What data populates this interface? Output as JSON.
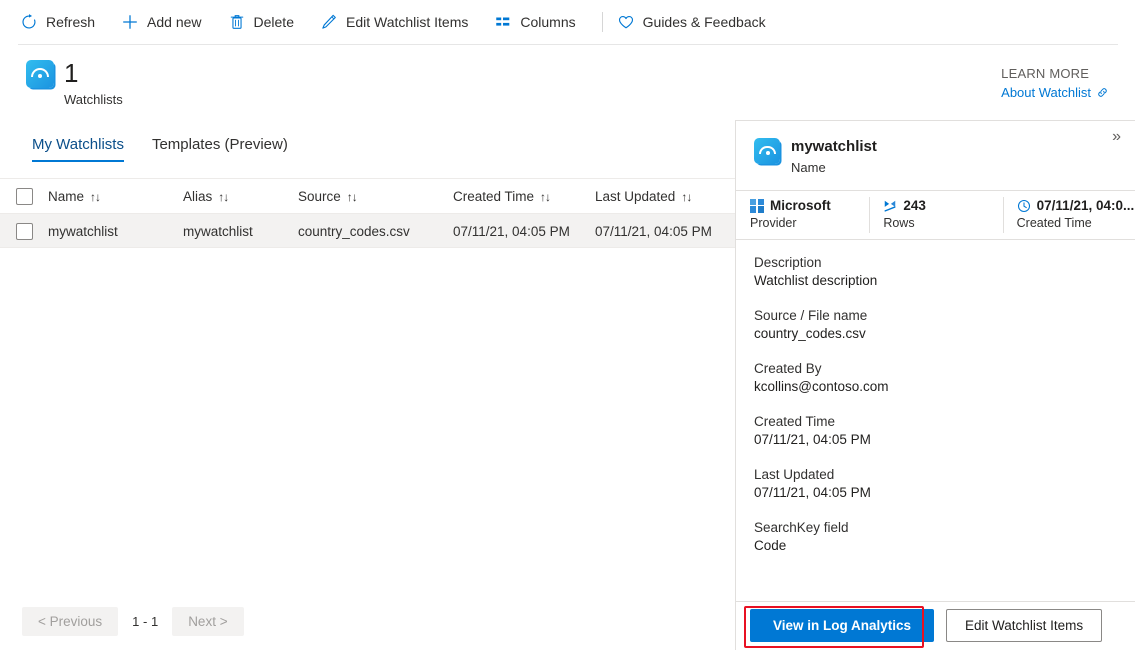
{
  "toolbar": {
    "items": [
      {
        "label": "Refresh",
        "icon": "refresh-icon"
      },
      {
        "label": "Add new",
        "icon": "plus-icon"
      },
      {
        "label": "Delete",
        "icon": "trash-icon"
      },
      {
        "label": "Edit Watchlist Items",
        "icon": "pencil-icon"
      },
      {
        "label": "Columns",
        "icon": "columns-icon"
      },
      {
        "label": "Guides & Feedback",
        "icon": "heart-icon"
      }
    ]
  },
  "header": {
    "count": "1",
    "count_label": "Watchlists",
    "icon": "watchlist-icon",
    "learn_more_title": "LEARN MORE",
    "learn_more_link": "About Watchlist",
    "learn_more_icon": "external-link-icon"
  },
  "tabs": [
    {
      "label": "My Watchlists",
      "active": true
    },
    {
      "label": "Templates (Preview)",
      "active": false
    }
  ],
  "table": {
    "columns": [
      {
        "label": "Name",
        "sort": "↑↓"
      },
      {
        "label": "Alias",
        "sort": "↑↓"
      },
      {
        "label": "Source",
        "sort": "↑↓"
      },
      {
        "label": "Created Time",
        "sort": "↑↓"
      },
      {
        "label": "Last Updated",
        "sort": "↑↓"
      }
    ],
    "rows": [
      {
        "name": "mywatchlist",
        "alias": "mywatchlist",
        "source": "country_codes.csv",
        "created_time": "07/11/21, 04:05 PM",
        "last_updated": "07/11/21, 04:05 PM",
        "more": "•••",
        "selected": true,
        "checked": false
      }
    ]
  },
  "pagination": {
    "previous_label": "< Previous",
    "range_label": "1 - 1",
    "next_label": "Next >"
  },
  "panel": {
    "collapse_icon": "»",
    "title": "mywatchlist",
    "subtitle": "Name",
    "icon": "watchlist-icon",
    "stats": [
      {
        "value": "Microsoft",
        "label": "Provider",
        "icon": "microsoft-logo-icon"
      },
      {
        "value": "243",
        "label": "Rows",
        "icon": "rows-icon"
      },
      {
        "value": "07/11/21, 04:0...",
        "label": "Created Time",
        "icon": "clock-icon"
      }
    ],
    "fields": [
      {
        "label": "Description",
        "value": "Watchlist description"
      },
      {
        "label": "Source / File name",
        "value": "country_codes.csv"
      },
      {
        "label": "Created By",
        "value": "kcollins@contoso.com"
      },
      {
        "label": "Created Time",
        "value": "07/11/21, 04:05 PM"
      },
      {
        "label": "Last Updated",
        "value": "07/11/21, 04:05 PM"
      },
      {
        "label": "SearchKey field",
        "value": "Code"
      }
    ],
    "primary_button": "View in Log Analytics",
    "secondary_button": "Edit Watchlist Items"
  },
  "colors": {
    "accent": "#0078d4",
    "highlight": "#e81123",
    "selected_row": "#f3f2f1",
    "icon_blue": "#0078d4"
  }
}
